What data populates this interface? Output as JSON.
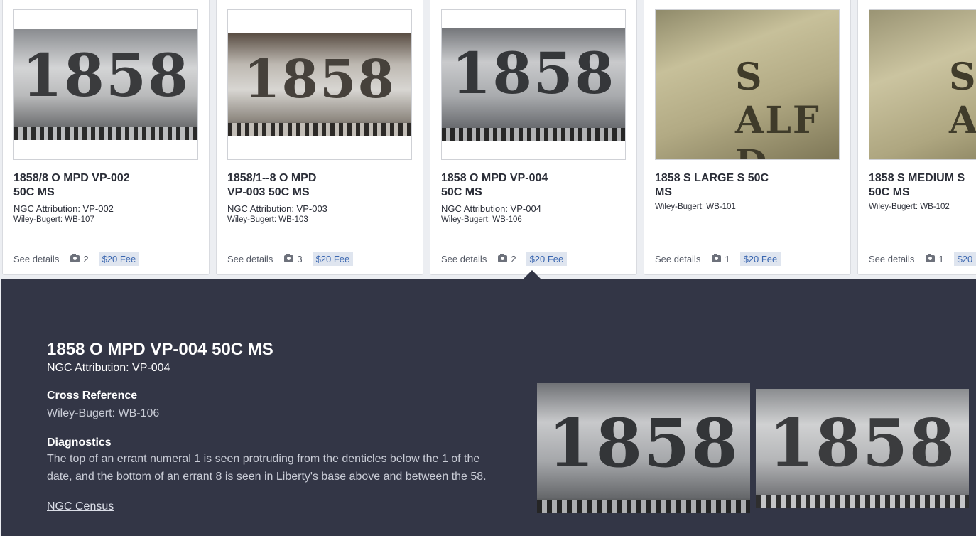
{
  "cards": [
    {
      "title": "1858/8 O MPD VP-002\n50C MS",
      "attribution": "NGC Attribution: VP-002",
      "cross_reference": "Wiley-Bugert: WB-107",
      "see_details": "See details",
      "photo_count": "2",
      "fee": "$20 Fee",
      "image_text": "1858"
    },
    {
      "title": "1858/1--8 O MPD\nVP-003 50C MS",
      "attribution": "NGC Attribution: VP-003",
      "cross_reference": "Wiley-Bugert: WB-103",
      "see_details": "See details",
      "photo_count": "3",
      "fee": "$20 Fee",
      "image_text": "1858"
    },
    {
      "title": "1858 O MPD VP-004\n50C MS",
      "attribution": "NGC Attribution: VP-004",
      "cross_reference": "Wiley-Bugert: WB-106",
      "see_details": "See details",
      "photo_count": "2",
      "fee": "$20 Fee",
      "image_text": "1858"
    },
    {
      "title": "1858 S LARGE S 50C\nMS",
      "attribution": "",
      "cross_reference": "Wiley-Bugert: WB-101",
      "see_details": "See details",
      "photo_count": "1",
      "fee": "$20 Fee",
      "image_text": "S ALF D"
    },
    {
      "title": "1858 S MEDIUM S\n50C MS",
      "attribution": "",
      "cross_reference": "Wiley-Bugert: WB-102",
      "see_details": "See details",
      "photo_count": "1",
      "fee": "$20",
      "image_text": "S ALF"
    }
  ],
  "detail": {
    "title": "1858 O MPD VP-004 50C MS",
    "attribution": "NGC Attribution: VP-004",
    "cross_reference_heading": "Cross Reference",
    "cross_reference": "Wiley-Bugert: WB-106",
    "diagnostics_heading": "Diagnostics",
    "diagnostics": "The top of an errant numeral 1 is seen protruding from the denticles below the 1 of the date, and the bottom of an errant 8 is seen in Liberty's base above and between the 58.",
    "census_link": "NGC Census",
    "image_text": "1858"
  },
  "colors": {
    "panel": "#333646",
    "fee_bg": "#dfe5ef",
    "fee_text": "#3a66b0",
    "page_bg": "#eceef2"
  },
  "icons": {
    "photo": "camera-icon"
  }
}
